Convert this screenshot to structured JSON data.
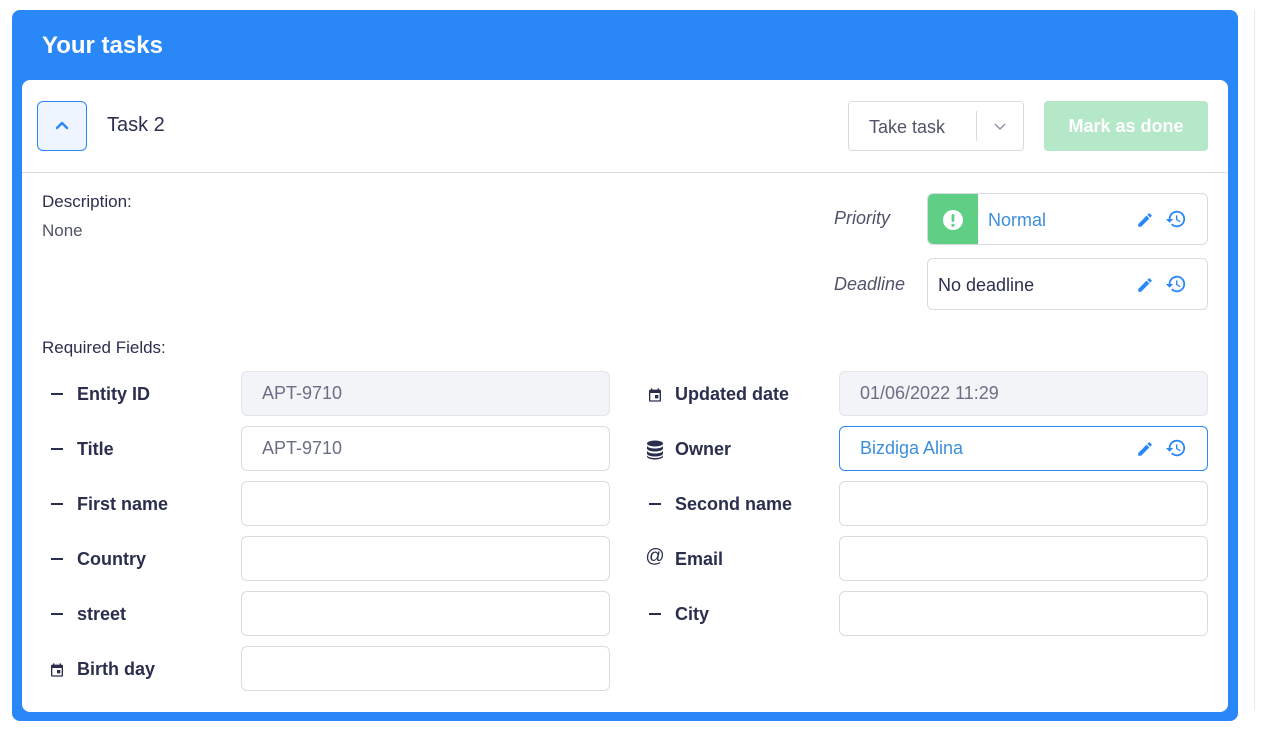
{
  "header": {
    "title": "Your tasks"
  },
  "task": {
    "title": "Task 2",
    "take_label": "Take task",
    "done_label": "Mark as done",
    "description_label": "Description:",
    "description_value": "None",
    "priority_label": "Priority",
    "priority_value": "Normal",
    "deadline_label": "Deadline",
    "deadline_value": "No deadline",
    "required_label": "Required Fields:"
  },
  "fields": {
    "entity_id": {
      "label": "Entity ID",
      "value": "APT-9710"
    },
    "title": {
      "label": "Title",
      "value": "APT-9710"
    },
    "first_name": {
      "label": "First name",
      "value": ""
    },
    "country": {
      "label": "Country",
      "value": ""
    },
    "street": {
      "label": "street",
      "value": ""
    },
    "birth_day": {
      "label": "Birth day",
      "value": ""
    },
    "updated_date": {
      "label": "Updated date",
      "value": "01/06/2022 11:29"
    },
    "owner": {
      "label": "Owner",
      "value": "Bizdiga Alina"
    },
    "second_name": {
      "label": "Second name",
      "value": ""
    },
    "email": {
      "label": "Email",
      "value": ""
    },
    "city": {
      "label": "City",
      "value": ""
    }
  },
  "icons": {
    "collapse": "chevron-up-icon",
    "take_caret": "chevron-down-icon",
    "priority": "exclamation-circle-icon",
    "edit": "pencil-icon",
    "history": "history-icon",
    "dash": "dash-icon",
    "calendar": "calendar-icon",
    "database": "database-icon",
    "email": "at-icon"
  },
  "colors": {
    "primary": "#2a87f8",
    "success": "#5fcf86",
    "success_disabled": "#b5e8c8",
    "text": "#2b2f4e",
    "link": "#3d8fdc"
  }
}
